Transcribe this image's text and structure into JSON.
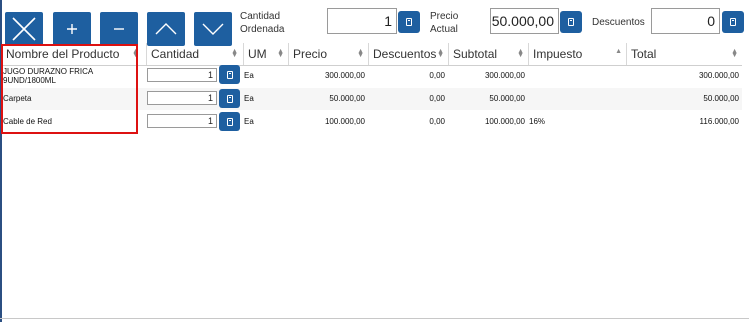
{
  "toolbar": {
    "qty_label": "Cantidad Ordenada",
    "qty_value": "1",
    "price_label": "Precio Actual",
    "price_value": "50.000,00",
    "discount_label": "Descuentos",
    "discount_value": "0"
  },
  "columns": [
    "Nombre del Producto",
    "Cantidad",
    "UM",
    "Precio",
    "Descuentos",
    "Subtotal",
    "Impuesto",
    "Total"
  ],
  "rows": [
    {
      "name": "JUGO DURAZNO FRICA 9UND/1800ML",
      "qty": "1",
      "um": "Ea",
      "price": "300.000,00",
      "discount": "0,00",
      "subtotal": "300.000,00",
      "tax": "",
      "total": "300.000,00"
    },
    {
      "name": "Carpeta",
      "qty": "1",
      "um": "Ea",
      "price": "50.000,00",
      "discount": "0,00",
      "subtotal": "50.000,00",
      "tax": "",
      "total": "50.000,00"
    },
    {
      "name": "Cable de Red",
      "qty": "1",
      "um": "Ea",
      "price": "100.000,00",
      "discount": "0,00",
      "subtotal": "100.000,00",
      "tax": "16%",
      "total": "116.000,00"
    }
  ],
  "colors": {
    "accent": "#1e5fa0",
    "highlight": "#dd1111"
  }
}
